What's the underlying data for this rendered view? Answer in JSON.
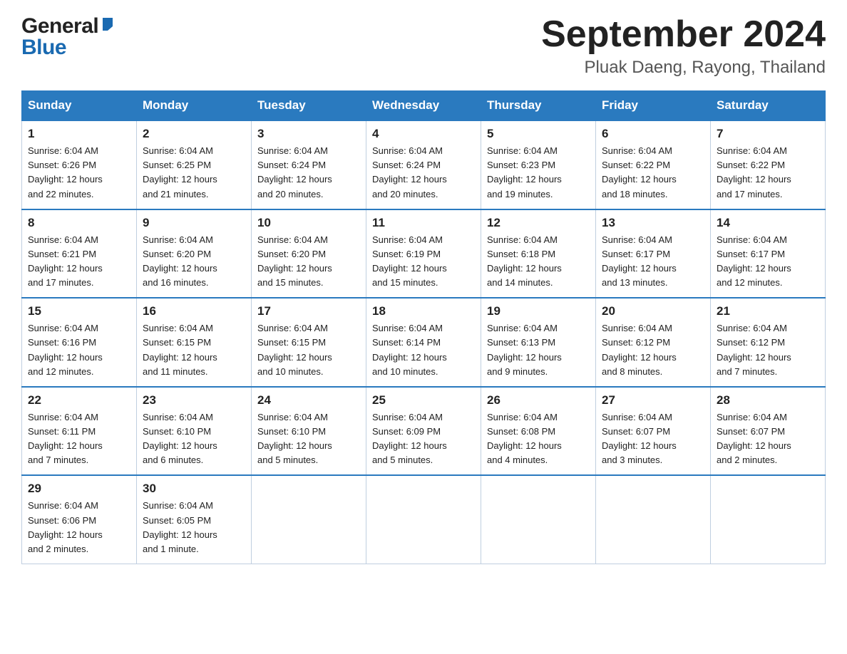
{
  "header": {
    "logo_general": "General",
    "logo_blue": "Blue",
    "month_title": "September 2024",
    "location": "Pluak Daeng, Rayong, Thailand"
  },
  "days_of_week": [
    "Sunday",
    "Monday",
    "Tuesday",
    "Wednesday",
    "Thursday",
    "Friday",
    "Saturday"
  ],
  "weeks": [
    [
      {
        "day": "1",
        "sunrise": "6:04 AM",
        "sunset": "6:26 PM",
        "daylight": "12 hours and 22 minutes."
      },
      {
        "day": "2",
        "sunrise": "6:04 AM",
        "sunset": "6:25 PM",
        "daylight": "12 hours and 21 minutes."
      },
      {
        "day": "3",
        "sunrise": "6:04 AM",
        "sunset": "6:24 PM",
        "daylight": "12 hours and 20 minutes."
      },
      {
        "day": "4",
        "sunrise": "6:04 AM",
        "sunset": "6:24 PM",
        "daylight": "12 hours and 20 minutes."
      },
      {
        "day": "5",
        "sunrise": "6:04 AM",
        "sunset": "6:23 PM",
        "daylight": "12 hours and 19 minutes."
      },
      {
        "day": "6",
        "sunrise": "6:04 AM",
        "sunset": "6:22 PM",
        "daylight": "12 hours and 18 minutes."
      },
      {
        "day": "7",
        "sunrise": "6:04 AM",
        "sunset": "6:22 PM",
        "daylight": "12 hours and 17 minutes."
      }
    ],
    [
      {
        "day": "8",
        "sunrise": "6:04 AM",
        "sunset": "6:21 PM",
        "daylight": "12 hours and 17 minutes."
      },
      {
        "day": "9",
        "sunrise": "6:04 AM",
        "sunset": "6:20 PM",
        "daylight": "12 hours and 16 minutes."
      },
      {
        "day": "10",
        "sunrise": "6:04 AM",
        "sunset": "6:20 PM",
        "daylight": "12 hours and 15 minutes."
      },
      {
        "day": "11",
        "sunrise": "6:04 AM",
        "sunset": "6:19 PM",
        "daylight": "12 hours and 15 minutes."
      },
      {
        "day": "12",
        "sunrise": "6:04 AM",
        "sunset": "6:18 PM",
        "daylight": "12 hours and 14 minutes."
      },
      {
        "day": "13",
        "sunrise": "6:04 AM",
        "sunset": "6:17 PM",
        "daylight": "12 hours and 13 minutes."
      },
      {
        "day": "14",
        "sunrise": "6:04 AM",
        "sunset": "6:17 PM",
        "daylight": "12 hours and 12 minutes."
      }
    ],
    [
      {
        "day": "15",
        "sunrise": "6:04 AM",
        "sunset": "6:16 PM",
        "daylight": "12 hours and 12 minutes."
      },
      {
        "day": "16",
        "sunrise": "6:04 AM",
        "sunset": "6:15 PM",
        "daylight": "12 hours and 11 minutes."
      },
      {
        "day": "17",
        "sunrise": "6:04 AM",
        "sunset": "6:15 PM",
        "daylight": "12 hours and 10 minutes."
      },
      {
        "day": "18",
        "sunrise": "6:04 AM",
        "sunset": "6:14 PM",
        "daylight": "12 hours and 10 minutes."
      },
      {
        "day": "19",
        "sunrise": "6:04 AM",
        "sunset": "6:13 PM",
        "daylight": "12 hours and 9 minutes."
      },
      {
        "day": "20",
        "sunrise": "6:04 AM",
        "sunset": "6:12 PM",
        "daylight": "12 hours and 8 minutes."
      },
      {
        "day": "21",
        "sunrise": "6:04 AM",
        "sunset": "6:12 PM",
        "daylight": "12 hours and 7 minutes."
      }
    ],
    [
      {
        "day": "22",
        "sunrise": "6:04 AM",
        "sunset": "6:11 PM",
        "daylight": "12 hours and 7 minutes."
      },
      {
        "day": "23",
        "sunrise": "6:04 AM",
        "sunset": "6:10 PM",
        "daylight": "12 hours and 6 minutes."
      },
      {
        "day": "24",
        "sunrise": "6:04 AM",
        "sunset": "6:10 PM",
        "daylight": "12 hours and 5 minutes."
      },
      {
        "day": "25",
        "sunrise": "6:04 AM",
        "sunset": "6:09 PM",
        "daylight": "12 hours and 5 minutes."
      },
      {
        "day": "26",
        "sunrise": "6:04 AM",
        "sunset": "6:08 PM",
        "daylight": "12 hours and 4 minutes."
      },
      {
        "day": "27",
        "sunrise": "6:04 AM",
        "sunset": "6:07 PM",
        "daylight": "12 hours and 3 minutes."
      },
      {
        "day": "28",
        "sunrise": "6:04 AM",
        "sunset": "6:07 PM",
        "daylight": "12 hours and 2 minutes."
      }
    ],
    [
      {
        "day": "29",
        "sunrise": "6:04 AM",
        "sunset": "6:06 PM",
        "daylight": "12 hours and 2 minutes."
      },
      {
        "day": "30",
        "sunrise": "6:04 AM",
        "sunset": "6:05 PM",
        "daylight": "12 hours and 1 minute."
      },
      null,
      null,
      null,
      null,
      null
    ]
  ],
  "labels": {
    "sunrise": "Sunrise:",
    "sunset": "Sunset:",
    "daylight": "Daylight:"
  }
}
